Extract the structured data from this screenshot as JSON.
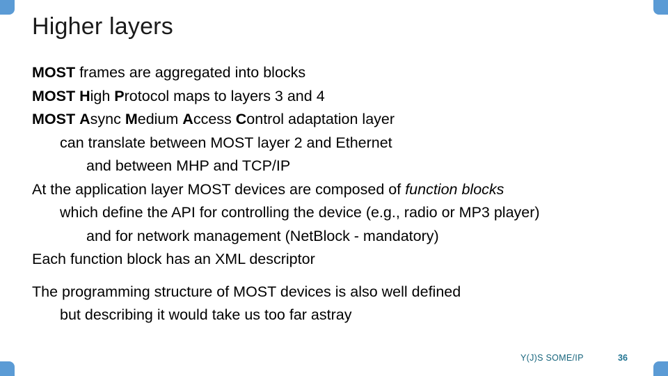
{
  "slide": {
    "title": "Higher layers",
    "theme": {
      "corner_color": "#5b9bd5",
      "footer_color": "#17657d",
      "page_number_color": "#1f7391",
      "text_color": "#000000",
      "background": "#ffffff"
    }
  },
  "body": {
    "lines": [
      {
        "indent": 0,
        "segments": [
          {
            "text": "MOST",
            "style": "bold"
          },
          {
            "text": " frames are aggregated into blocks",
            "style": "normal"
          }
        ]
      },
      {
        "indent": 0,
        "segments": [
          {
            "text": "MOST",
            "style": "bold"
          },
          {
            "text": " ",
            "style": "normal"
          },
          {
            "text": "H",
            "style": "bold"
          },
          {
            "text": "igh ",
            "style": "normal"
          },
          {
            "text": "P",
            "style": "bold"
          },
          {
            "text": "rotocol maps to layers 3 and 4",
            "style": "normal"
          }
        ]
      },
      {
        "indent": 0,
        "segments": [
          {
            "text": "MOST",
            "style": "bold"
          },
          {
            "text": " ",
            "style": "normal"
          },
          {
            "text": "A",
            "style": "bold"
          },
          {
            "text": "sync ",
            "style": "normal"
          },
          {
            "text": "M",
            "style": "bold"
          },
          {
            "text": "edium ",
            "style": "normal"
          },
          {
            "text": "A",
            "style": "bold"
          },
          {
            "text": "ccess ",
            "style": "normal"
          },
          {
            "text": "C",
            "style": "bold"
          },
          {
            "text": "ontrol adaptation layer",
            "style": "normal"
          }
        ]
      },
      {
        "indent": 1,
        "segments": [
          {
            "text": "can translate between MOST layer 2 and Ethernet",
            "style": "normal"
          }
        ]
      },
      {
        "indent": 2,
        "segments": [
          {
            "text": "and between MHP and TCP/IP",
            "style": "normal"
          }
        ]
      },
      {
        "indent": 0,
        "segments": [
          {
            "text": "At the application layer MOST devices are composed of ",
            "style": "normal"
          },
          {
            "text": "function blocks",
            "style": "italic"
          }
        ]
      },
      {
        "indent": 1,
        "segments": [
          {
            "text": "which define the API for controlling the device (e.g., radio or MP3 player)",
            "style": "normal"
          }
        ]
      },
      {
        "indent": 2,
        "segments": [
          {
            "text": "and for network management (NetBlock - mandatory)",
            "style": "normal"
          }
        ]
      },
      {
        "indent": 0,
        "segments": [
          {
            "text": "Each function block has an XML descriptor",
            "style": "normal"
          }
        ]
      },
      {
        "spacer": true
      },
      {
        "indent": 0,
        "segments": [
          {
            "text": "The programming structure of MOST devices is also well defined",
            "style": "normal"
          }
        ]
      },
      {
        "indent": 1,
        "segments": [
          {
            "text": "but describing it would take us too far astray",
            "style": "normal"
          }
        ]
      }
    ]
  },
  "footer": {
    "label": "Y(J)S  SOME/IP",
    "page_number": "36"
  }
}
